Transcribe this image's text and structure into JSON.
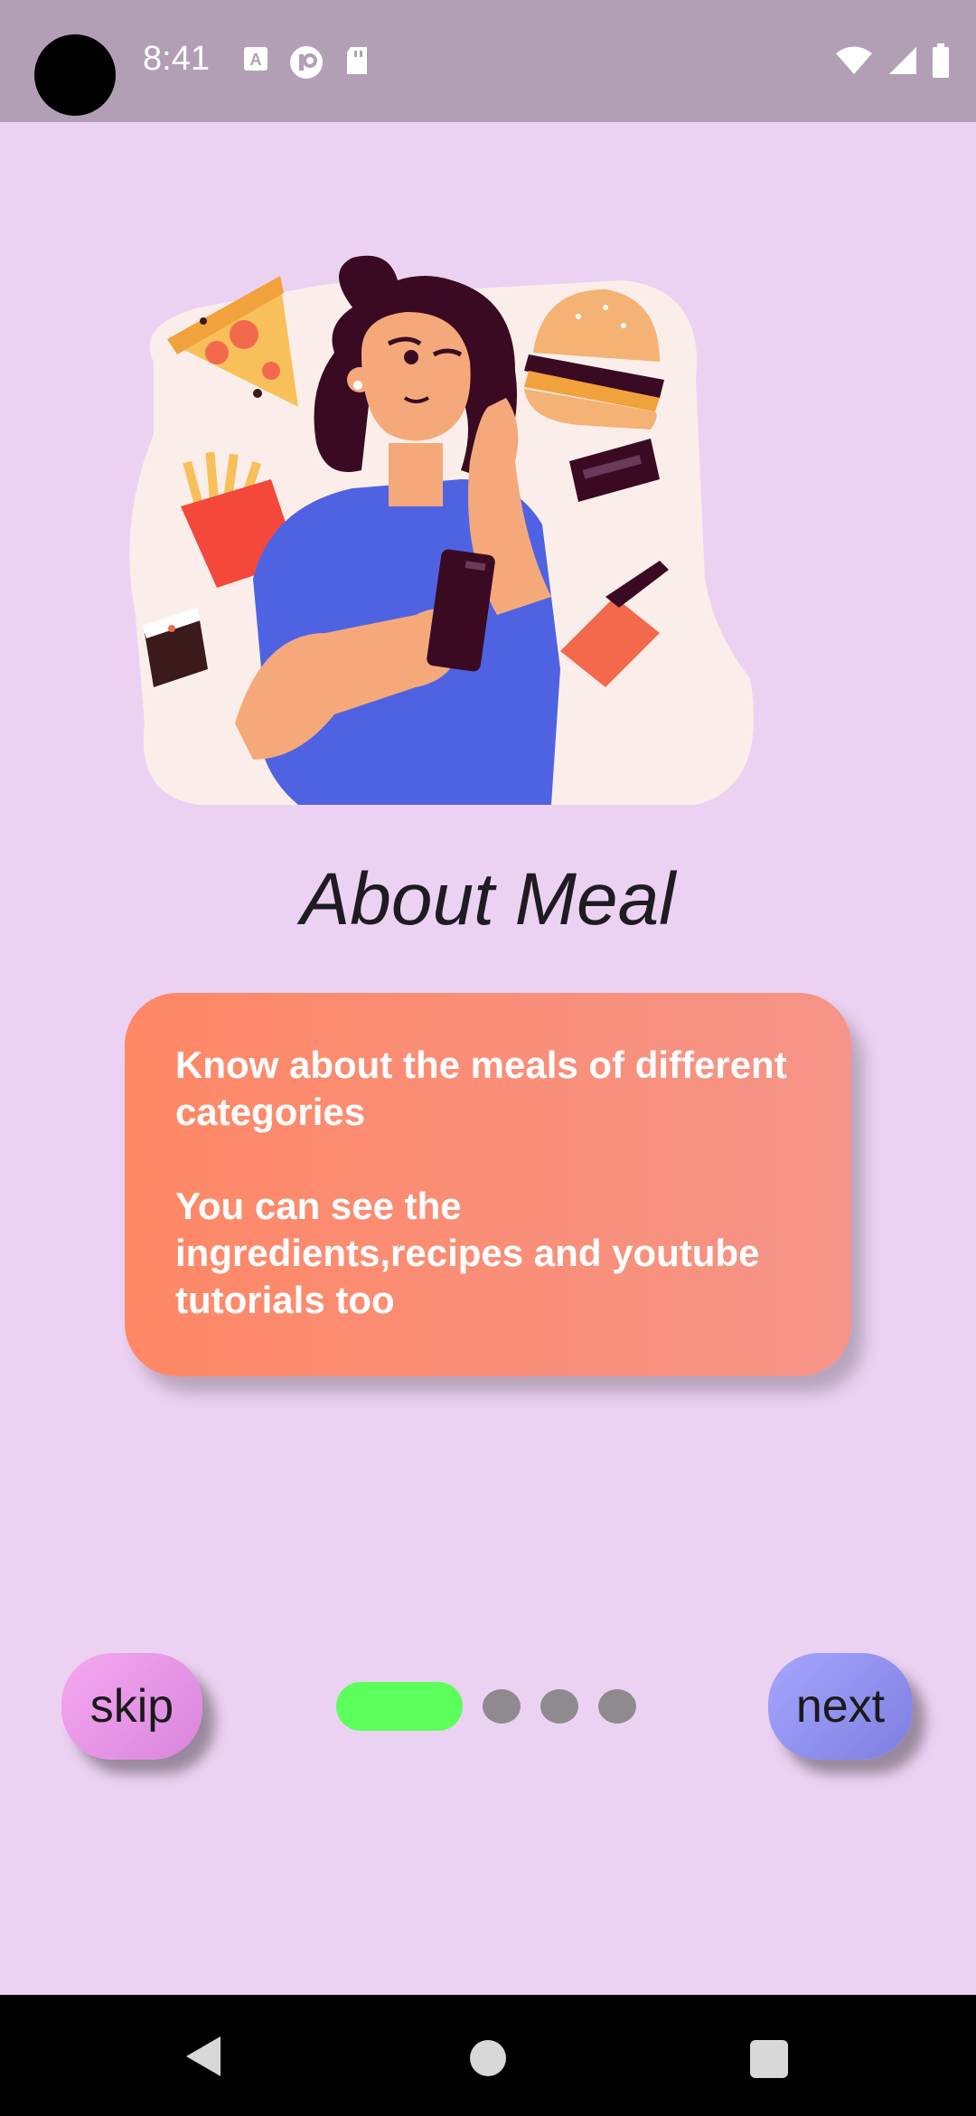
{
  "status_bar": {
    "time": "8:41",
    "left_icons": [
      "font-icon",
      "circle-p-icon",
      "sd-card-icon"
    ],
    "right_icons": [
      "wifi-icon",
      "signal-icon",
      "battery-icon"
    ]
  },
  "illustration": {
    "description_icon": "woman-thinking-fast-food-illustration"
  },
  "page": {
    "title": "About Meal",
    "card_paragraphs": [
      "Know about the meals of different categories",
      "You can see the ingredients,recipes and youtube tutorials too"
    ]
  },
  "controls": {
    "skip_label": "skip",
    "next_label": "next",
    "page_count": 4,
    "current_page": 1
  },
  "colors": {
    "background": "#ecd2f2",
    "card_gradient_start": "#ff8866",
    "card_gradient_end": "#f59488",
    "active_indicator": "#5cff5c",
    "inactive_indicator": "#8e8a8e"
  },
  "nav_bar": {
    "icons": [
      "back-icon",
      "home-icon",
      "recents-icon"
    ]
  }
}
